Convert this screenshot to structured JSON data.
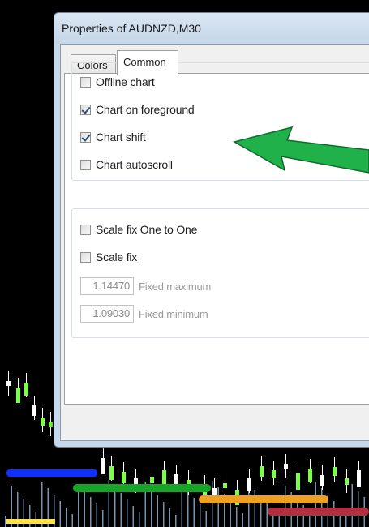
{
  "window": {
    "title": "Properties of AUDNZD,M30"
  },
  "tabs": [
    {
      "label": "Colors",
      "active": false
    },
    {
      "label": "Common",
      "active": true
    }
  ],
  "group_display": {
    "items": [
      {
        "label": "Offline chart",
        "checked": false
      },
      {
        "label": "Chart on foreground",
        "checked": true
      },
      {
        "label": "Chart shift",
        "checked": true
      },
      {
        "label": "Chart autoscroll",
        "checked": false
      }
    ]
  },
  "group_scale": {
    "items": [
      {
        "label": "Scale fix One to One",
        "checked": false
      },
      {
        "label": "Scale fix",
        "checked": false
      }
    ],
    "fixed_max": {
      "value": "1.14470",
      "label": "Fixed maximum"
    },
    "fixed_min": {
      "value": "1.09030",
      "label": "Fixed minimum"
    }
  },
  "colors": {
    "arrow_fill": "#20b14a",
    "arrow_stroke": "#0f6a2c",
    "line_blue": "#1030ff",
    "line_green": "#1aa32a",
    "line_orange": "#f0a020",
    "line_red": "#b03040",
    "candle_up": "#7cff4a",
    "candle_wick": "#ffffff",
    "volume": "#9fc6e8",
    "accent_yellow": "#ffe14a"
  }
}
